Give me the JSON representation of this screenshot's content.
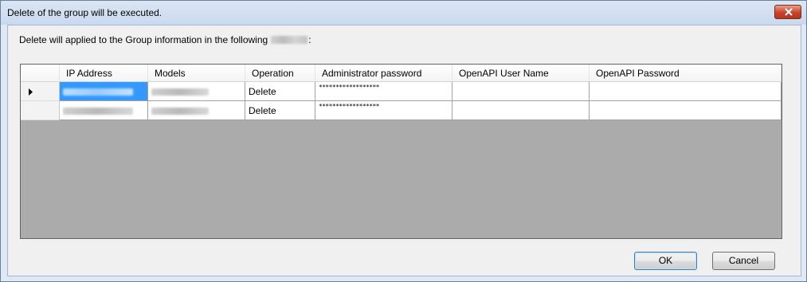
{
  "window": {
    "title": "Delete of the group will be executed."
  },
  "message": {
    "prefix": "Delete will applied to the Group information in the following",
    "suffix": ":"
  },
  "grid": {
    "columns": [
      "",
      "IP Address",
      "Models",
      "Operation",
      "Administrator password",
      "OpenAPI User Name",
      "OpenAPI Password"
    ],
    "rows": [
      {
        "ip": "",
        "model": "",
        "operation": "Delete",
        "admin_password": "******************",
        "openapi_user": "",
        "openapi_password": "",
        "current": true
      },
      {
        "ip": "",
        "model": "",
        "operation": "Delete",
        "admin_password": "******************",
        "openapi_user": "",
        "openapi_password": "",
        "current": false
      }
    ]
  },
  "buttons": {
    "ok": "OK",
    "cancel": "Cancel"
  },
  "colors": {
    "selection": "#3399ff",
    "close_button": "#c7432a"
  },
  "icons": {
    "close": "close-icon",
    "current_row": "row-pointer-icon"
  }
}
